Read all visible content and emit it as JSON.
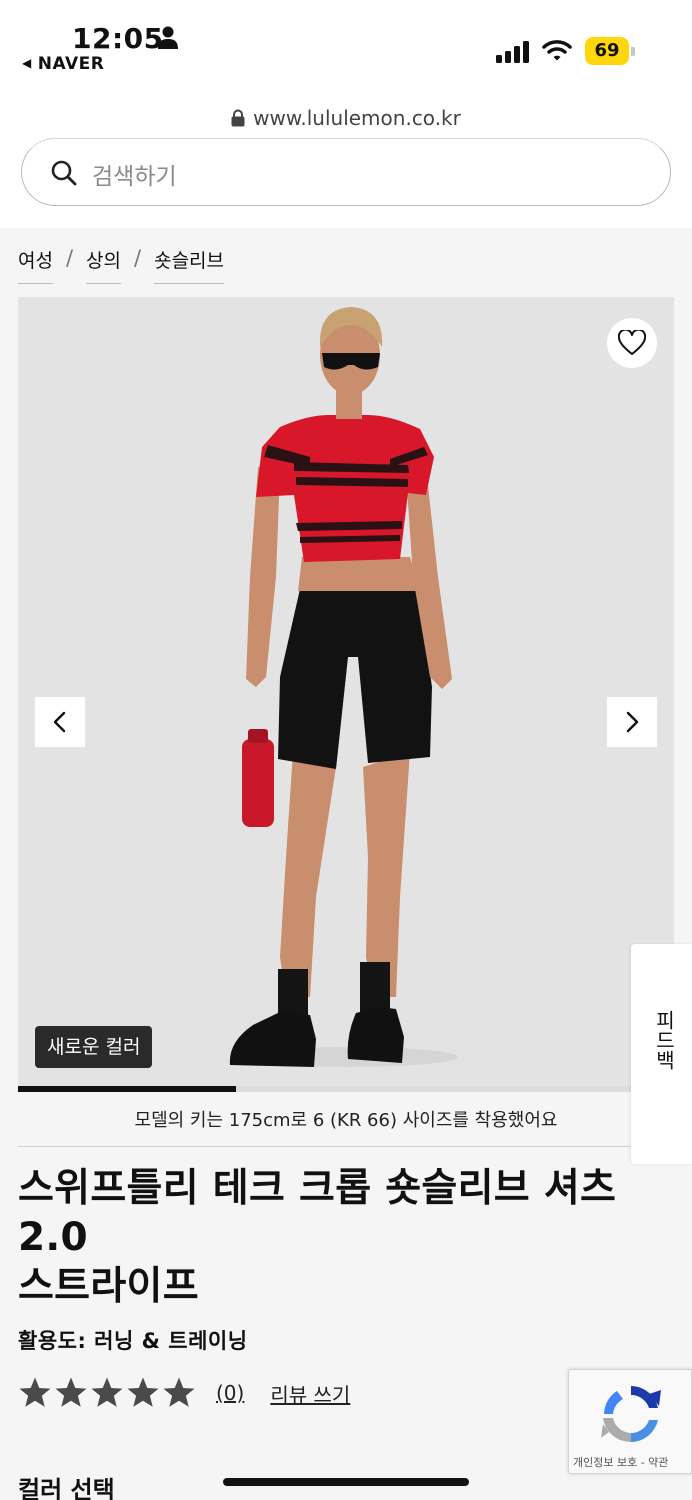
{
  "status_bar": {
    "time": "12:05",
    "back_app": "NAVER",
    "battery": "69"
  },
  "browser": {
    "url": "www.lululemon.co.kr"
  },
  "search": {
    "placeholder": "검색하기"
  },
  "breadcrumb": [
    "여성",
    "상의",
    "숏슬리브"
  ],
  "gallery": {
    "badge": "새로운 컬러",
    "progress_fraction": 0.333,
    "model_note": "모델의 키는 175cm로 6 (KR 66) 사이즈를 착용했어요"
  },
  "feedback_tab": {
    "label": "피드백"
  },
  "product": {
    "title_line1": "스위프틀리 테크 크롭 숏슬리브 셔츠",
    "title_line2": "2.0",
    "title_line3": "스트라이프",
    "activity": "활용도: 러닝 & 트레이닝",
    "rating_stars": 5,
    "rating_count": "(0)",
    "write_review": "리뷰 쓰기"
  },
  "recaptcha": {
    "text": "개인정보 보호 - 약관"
  },
  "sections": {
    "color_select": "컬러 선택"
  },
  "colors": {
    "shirt_red": "#d8172b",
    "stripe": "#2a1214",
    "shorts": "#121212",
    "skin": "#c98e6e",
    "hair": "#c9a273",
    "badge_bg": "#2b2a2a",
    "battery": "#ffd60a"
  }
}
